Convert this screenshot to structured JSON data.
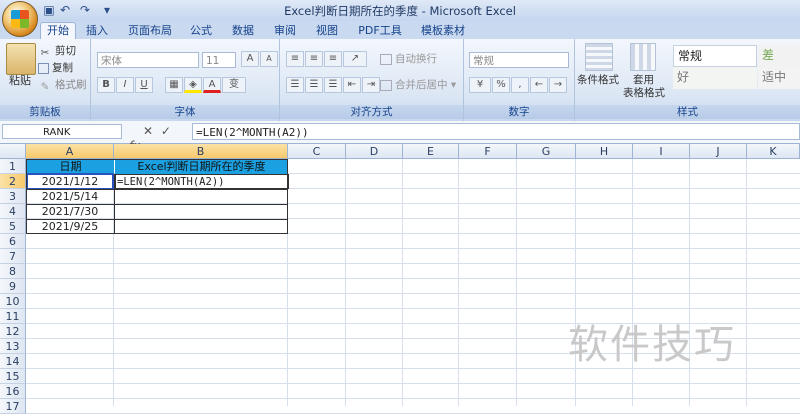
{
  "window": {
    "title": "Excel判断日期所在的季度 - Microsoft Excel"
  },
  "tabs": [
    "开始",
    "插入",
    "页面布局",
    "公式",
    "数据",
    "审阅",
    "视图",
    "PDF工具",
    "模板素材"
  ],
  "ribbon": {
    "clipboard": {
      "paste": "粘贴",
      "cut": "剪切",
      "copy": "复制",
      "format_painter": "格式刷",
      "label": "剪贴板"
    },
    "font": {
      "name": "宋体",
      "size": "11",
      "grow": "A",
      "shrink": "A",
      "bold": "B",
      "italic": "I",
      "underline": "U",
      "label": "字体"
    },
    "alignment": {
      "wrap": "自动换行",
      "merge": "合并后居中",
      "label": "对齐方式"
    },
    "number": {
      "format": "常规",
      "percent": "%",
      "comma": ",",
      "label": "数字"
    },
    "styles": {
      "conditional": "条件格式",
      "table_format": "套用",
      "table_format2": "表格格式",
      "normal": "常规",
      "bad": "差",
      "good": "好",
      "neutral": "适中",
      "label": "样式"
    }
  },
  "formula_bar": {
    "name_box": "RANK",
    "cancel": "✕",
    "enter": "✓",
    "fx": "fx",
    "formula": "=LEN(2^MONTH(A2))"
  },
  "columns": [
    "A",
    "B",
    "C",
    "D",
    "E",
    "F",
    "G",
    "H",
    "I",
    "J",
    "K"
  ],
  "rows": [
    "1",
    "2",
    "3",
    "4",
    "5",
    "6",
    "7",
    "8",
    "9",
    "10",
    "11",
    "12",
    "13",
    "14",
    "15",
    "16",
    "17"
  ],
  "sheet": {
    "a1": "日期",
    "b1": "Excel判断日期所在的季度",
    "dates": [
      "2021/1/12",
      "2021/5/14",
      "2021/7/30",
      "2021/9/25"
    ],
    "b2": "=LEN(2^MONTH(A2))"
  },
  "watermark": "软件技巧",
  "colors": {
    "header_fill": "#1ba1e2",
    "selected_header": "#f7c96b",
    "ribbon_blue": "#15428b"
  }
}
